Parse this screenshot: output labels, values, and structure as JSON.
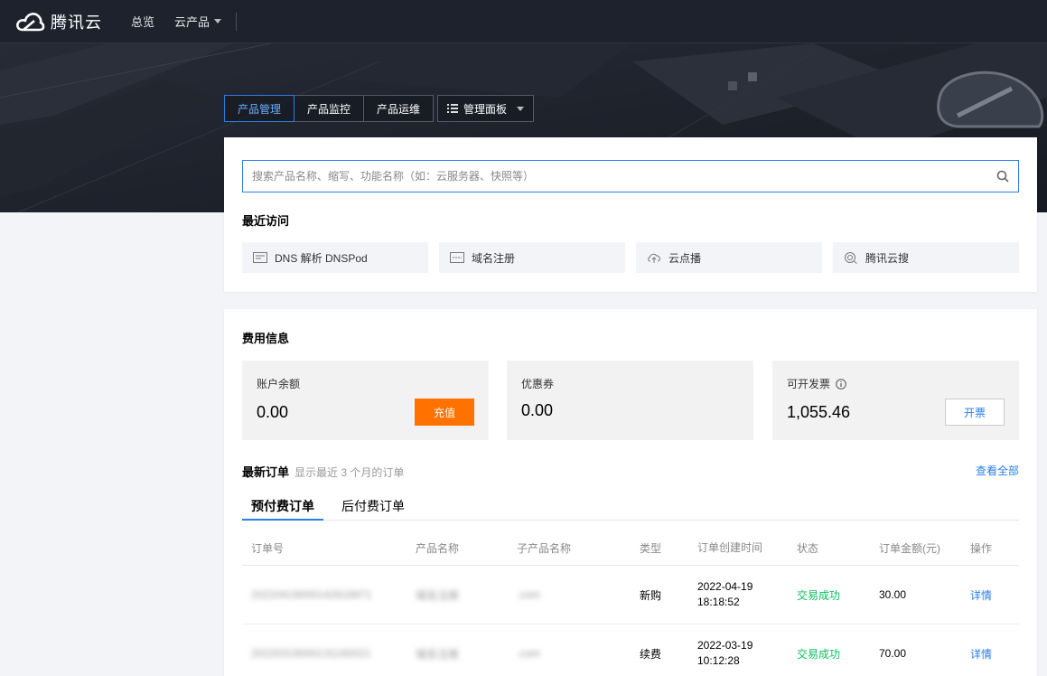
{
  "nav": {
    "brand": "腾讯云",
    "items": [
      {
        "label": "总览"
      },
      {
        "label": "云产品"
      }
    ]
  },
  "tabs": [
    {
      "label": "产品管理",
      "active": true
    },
    {
      "label": "产品监控",
      "active": false
    },
    {
      "label": "产品运维",
      "active": false
    }
  ],
  "panel_button": {
    "label": "管理面板"
  },
  "search": {
    "placeholder": "搜索产品名称、缩写、功能名称（如：云服务器、快照等）",
    "value": ""
  },
  "recent": {
    "title": "最近访问",
    "items": [
      {
        "label": "DNS 解析 DNSPod",
        "icon": "dns-icon"
      },
      {
        "label": "域名注册",
        "icon": "domain-icon"
      },
      {
        "label": "云点播",
        "icon": "cloud-upload-icon"
      },
      {
        "label": "腾讯云搜",
        "icon": "search-cloud-icon"
      }
    ]
  },
  "billing": {
    "title": "费用信息",
    "balance": {
      "label": "账户余额",
      "value": "0.00",
      "button": "充值"
    },
    "coupon": {
      "label": "优惠券",
      "value": "0.00"
    },
    "invoice": {
      "label": "可开发票",
      "value": "1,055.46",
      "button": "开票"
    }
  },
  "orders": {
    "title": "最新订单",
    "subtitle": "显示最近 3 个月的订单",
    "view_all": "查看全部",
    "tabs": [
      {
        "label": "预付费订单",
        "active": true
      },
      {
        "label": "后付费订单",
        "active": false
      }
    ],
    "columns": [
      "订单号",
      "产品名称",
      "子产品名称",
      "类型",
      "订单创建时间",
      "状态",
      "订单金额(元)",
      "操作"
    ],
    "rows": [
      {
        "order_no": "20220419000142818971",
        "product": "域名注册",
        "sub_product": ".com",
        "type": "新购",
        "date": "2022-04-19",
        "time": "18:18:52",
        "status": "交易成功",
        "amount": "30.00",
        "action": "详情"
      },
      {
        "order_no": "20220319000131160021",
        "product": "域名注册",
        "sub_product": ".com",
        "type": "续费",
        "date": "2022-03-19",
        "time": "10:12:28",
        "status": "交易成功",
        "amount": "70.00",
        "action": "详情"
      }
    ]
  },
  "colors": {
    "accent": "#2b7ee5",
    "orange": "#ff7200",
    "success": "#0abf5b",
    "nav_bg": "#1e222d"
  }
}
